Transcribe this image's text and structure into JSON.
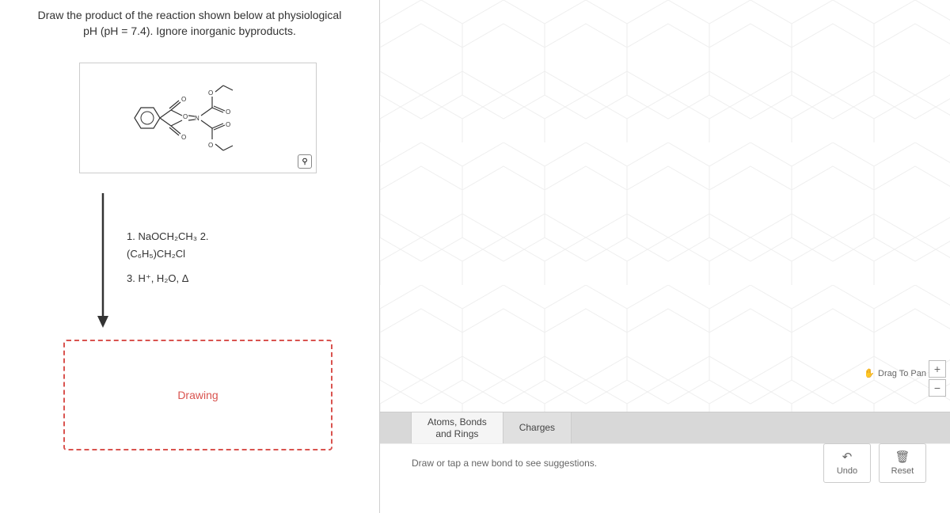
{
  "question": {
    "line1": "Draw the product of the reaction shown below at physiological",
    "line2": "pH (pH = 7.4). Ignore inorganic byproducts."
  },
  "reagents": {
    "step1": "1. NaOCH₂CH₃ 2.",
    "step2": "(C₆H₅)CH₂Cl",
    "step3": "3. H⁺, H₂O, Δ"
  },
  "drawing_box": {
    "label": "Drawing"
  },
  "canvas": {
    "drag_label": "Drag To Pan",
    "zoom_in": "+",
    "zoom_out": "−"
  },
  "tabs": {
    "atoms_bonds": "Atoms, Bonds\nand Rings",
    "charges": "Charges"
  },
  "hint": "Draw or tap a new bond to see suggestions.",
  "buttons": {
    "undo": "Undo",
    "reset": "Reset"
  },
  "icons": {
    "zoom": "⚲",
    "hand": "✋",
    "undo": "↶",
    "trash": "🗑"
  }
}
